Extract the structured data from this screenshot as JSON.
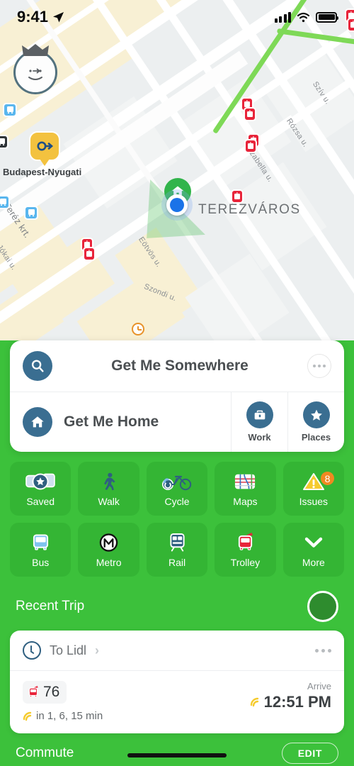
{
  "status_bar": {
    "time": "9:41",
    "location_arrow_icon": "location-arrow-icon",
    "signal_icon": "cellular-signal-icon",
    "wifi_icon": "wifi-icon",
    "battery_icon": "battery-full-icon"
  },
  "map": {
    "district_label": "TERÉZVÁROS",
    "station_label": "Budapest-Nyugati",
    "streets": [
      {
        "name": "Szív u."
      },
      {
        "name": "Rózsa u."
      },
      {
        "name": "Izabella u."
      },
      {
        "name": "Teréz krt."
      },
      {
        "name": "Jókai u."
      },
      {
        "name": "Eötvös u."
      },
      {
        "name": "Szondi u."
      }
    ],
    "avatar_icon": "user-avatar-crown-icon",
    "current_location_icon": "current-location-dot-icon",
    "home_marker_icon": "home-pin-icon",
    "trolley_stop_icon": "trolley-stop-pin-icon",
    "bus_stop_icon": "bus-stop-pin-icon",
    "rail_station_icon": "rail-station-pin-icon",
    "clock_poi_icon": "clock-poi-icon"
  },
  "search_card": {
    "search_icon": "search-icon",
    "title": "Get Me Somewhere",
    "more_icon": "ellipsis-icon",
    "home_icon": "home-icon",
    "home_label": "Get Me Home",
    "work_icon": "briefcase-icon",
    "work_label": "Work",
    "places_icon": "star-icon",
    "places_label": "Places"
  },
  "shortcuts": {
    "row1": [
      {
        "label": "Saved",
        "icon": "saved-vehicles-star-icon"
      },
      {
        "label": "Walk",
        "icon": "walking-person-icon"
      },
      {
        "label": "Cycle",
        "icon": "bicycle-icon"
      },
      {
        "label": "Maps",
        "icon": "transit-map-icon"
      },
      {
        "label": "Issues",
        "icon": "warning-triangle-icon",
        "badge": "8"
      }
    ],
    "row2": [
      {
        "label": "Bus",
        "icon": "bus-icon"
      },
      {
        "label": "Metro",
        "icon": "metro-m-icon"
      },
      {
        "label": "Rail",
        "icon": "train-icon"
      },
      {
        "label": "Trolley",
        "icon": "trolleybus-icon"
      },
      {
        "label": "More",
        "icon": "chevron-down-icon"
      }
    ]
  },
  "recent_trip": {
    "section_title": "Recent Trip",
    "refresh_icon": "record-circle-button",
    "clock_icon": "clock-icon",
    "destination": "To Lidl",
    "chevron": "›",
    "more_icon": "ellipsis-icon",
    "route_icon": "trolleybus-icon",
    "route_number": "76",
    "departures": "in 1, 6, 15 min",
    "arrive_label": "Arrive",
    "arrive_time": "12:51 PM",
    "live_icon": "live-realtime-icon"
  },
  "commute": {
    "title": "Commute",
    "edit_label": "EDIT"
  },
  "colors": {
    "brand_green": "#3cc13b",
    "tile_green": "#34b534",
    "icon_blue": "#3a6e91",
    "badge_orange": "#f08921",
    "trolley_red": "#e8243a"
  }
}
